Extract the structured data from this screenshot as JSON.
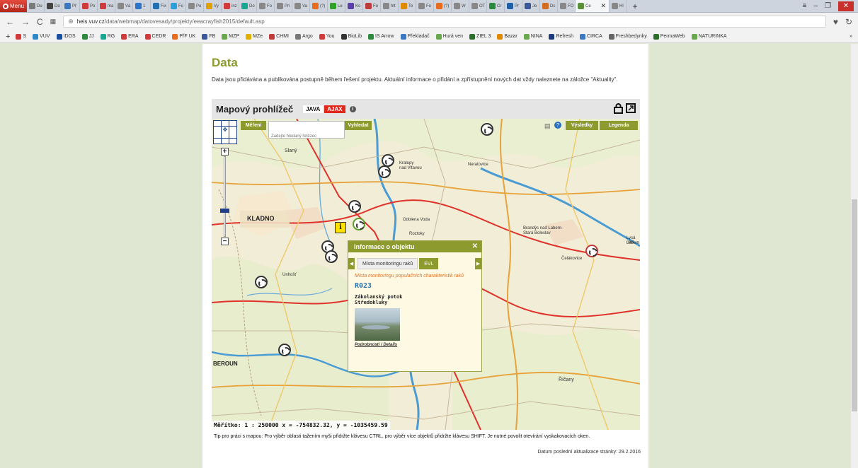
{
  "browser": {
    "menu_label": "Menu",
    "tabs": [
      {
        "label": "Do",
        "color": "#7a7a7a"
      },
      {
        "label": "Do",
        "color": "#444"
      },
      {
        "label": "Př",
        "color": "#3a78c2"
      },
      {
        "label": "Po",
        "color": "#d13b3b"
      },
      {
        "label": "ma",
        "color": "#d13b3b"
      },
      {
        "label": "Vá",
        "color": "#888"
      },
      {
        "label": "1",
        "color": "#2b74c9"
      },
      {
        "label": "Fix",
        "color": "#1f6fb2"
      },
      {
        "label": "Fo",
        "color": "#2aa0d8"
      },
      {
        "label": "Po",
        "color": "#888"
      },
      {
        "label": "Vy",
        "color": "#e0a000"
      },
      {
        "label": "inz",
        "color": "#d13b3b"
      },
      {
        "label": "Do",
        "color": "#17a690"
      },
      {
        "label": "Fo",
        "color": "#888"
      },
      {
        "label": "Pri",
        "color": "#888"
      },
      {
        "label": "Va",
        "color": "#888"
      },
      {
        "label": "(?)",
        "color": "#e86b1e"
      },
      {
        "label": "Le",
        "color": "#33a02c"
      },
      {
        "label": "Ko",
        "color": "#5a3fa8"
      },
      {
        "label": "Fo",
        "color": "#c03b3b"
      },
      {
        "label": "htt",
        "color": "#888"
      },
      {
        "label": "Te",
        "color": "#e08a00"
      },
      {
        "label": "Fo",
        "color": "#888"
      },
      {
        "label": "(?)",
        "color": "#e86b1e"
      },
      {
        "label": "W",
        "color": "#888"
      },
      {
        "label": "OT",
        "color": "#888"
      },
      {
        "label": "Cr",
        "color": "#2b8a3e"
      },
      {
        "label": "Pr",
        "color": "#1f5fa8"
      },
      {
        "label": "Je",
        "color": "#3b5998"
      },
      {
        "label": "Dc",
        "color": "#d36a1e"
      },
      {
        "label": "FO",
        "color": "#888"
      }
    ],
    "active_tab": {
      "label": "Ce",
      "color": "#5b8f3a"
    },
    "after_tab": {
      "label": "Hl",
      "color": "#888"
    },
    "url_domain": "heis.vuv.cz",
    "url_path": "/data/webmap/datovesady/projekty/eeacrayfish2015/default.asp",
    "bookmarks": [
      {
        "label": "S",
        "color": "#d13b3b"
      },
      {
        "label": "VUV",
        "color": "#2d89c8"
      },
      {
        "label": "IDOS",
        "color": "#1b4fa0"
      },
      {
        "label": "JJ",
        "color": "#2b8a3e"
      },
      {
        "label": "RG",
        "color": "#17a690"
      },
      {
        "label": "ERA",
        "color": "#d13b3b"
      },
      {
        "label": "CEDR",
        "color": "#d13b3b"
      },
      {
        "label": "PřF UK",
        "color": "#e86b1e"
      },
      {
        "label": "FB",
        "color": "#3b5998"
      },
      {
        "label": "MZP",
        "color": "#6aa84f"
      },
      {
        "label": "MZe",
        "color": "#e0b000"
      },
      {
        "label": "CHMI",
        "color": "#c03b3b"
      },
      {
        "label": "Argo",
        "color": "#777"
      },
      {
        "label": "You",
        "color": "#d13b3b"
      },
      {
        "label": "BioLib",
        "color": "#333"
      },
      {
        "label": "IS Arrow",
        "color": "#2b8a3e"
      },
      {
        "label": "Překladač",
        "color": "#3a78c2"
      },
      {
        "label": "Hurá ven",
        "color": "#6aa84f"
      },
      {
        "label": "ZIEL 3",
        "color": "#2b6e2b"
      },
      {
        "label": "Bazar",
        "color": "#e08a00"
      },
      {
        "label": "NINA",
        "color": "#6aa84f"
      },
      {
        "label": "Refresh",
        "color": "#1b3a7a"
      },
      {
        "label": "CIRCA",
        "color": "#3a78c2"
      },
      {
        "label": "Freshbedynky",
        "color": "#666"
      },
      {
        "label": "PermaWeb",
        "color": "#2b6e2b"
      },
      {
        "label": "NATURINKA",
        "color": "#6aa84f"
      }
    ],
    "bookmarks_more": "»"
  },
  "page": {
    "title": "Data",
    "intro": "Data jsou přidávána a publikována postupně během řešení projektu. Aktuální informace o přidání a zpřístupnění nových dat vždy naleznete na záložce \"Aktuality\".",
    "viewer_title": "Mapový prohlížeč",
    "java_label": "JAVA",
    "ajax_label": "AJAX",
    "tip": "Tip pro práci s mapou: Pro výběr oblasti tažením myši přidržte klávesu CTRL, pro výběr více objektů přidržte klávesu SHIFT. Je nutné povolit otevírání vyskakovacích oken.",
    "updated": "Datum poslední aktualizace stránky: 29.2.2016"
  },
  "map": {
    "measure_label": "Měření",
    "search_label": "Vyhledat",
    "search_hint": "Zadejte hledaný řetězec",
    "results_label": "Výsledky",
    "legend_label": "Legenda",
    "scale_text": "Měřítko: 1 : 250000 x = -754832.32, y = -1035459.59",
    "place_labels": {
      "kladno": "KLADNO",
      "slany": "Slaný",
      "kralupy": "Kralupy",
      "vltavou": "nad Vltavou",
      "neratovice": "Neratovice",
      "brandys": "Brandýs nad Labem-",
      "brandys2": "Stará Boleslav",
      "celakovice": "Čelákovice",
      "lysa": "Lysá nad",
      "labem": "Labem",
      "roztoky": "Roztoky",
      "beroun": "BEROUN",
      "ricany": "Říčany",
      "odolena": "Odolena Voda",
      "unhost": "Unhošť"
    }
  },
  "popup": {
    "title": "Informace o objektu",
    "tab1": "Místa monitoringu raků",
    "tab2": "EVL",
    "subtitle": "Místa monitoringu populačních charakteristik raků",
    "code": "R023",
    "name_line1": "Zákolanský potok",
    "name_line2": "Středokluky",
    "details_link": "Podrobnosti / Details"
  }
}
